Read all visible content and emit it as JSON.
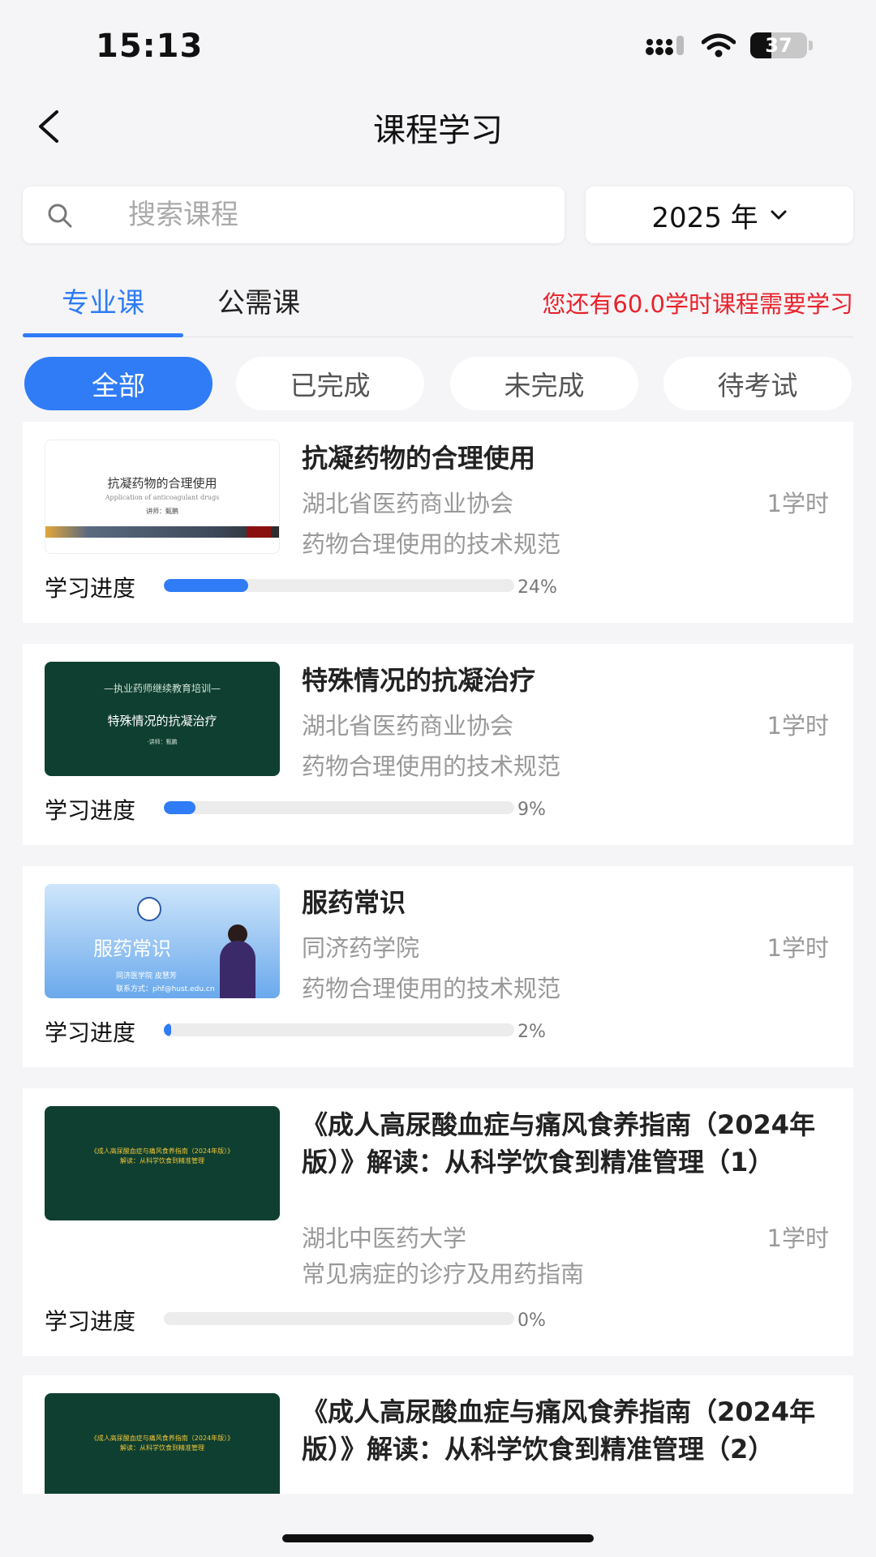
{
  "status_bar": {
    "time": "15:13",
    "battery": "37",
    "battery_level": 0.37
  },
  "header": {
    "title": "课程学习"
  },
  "search": {
    "placeholder": "搜索课程"
  },
  "year_filter": {
    "label": "2025 年"
  },
  "tabs": [
    {
      "label": "专业课",
      "active": true
    },
    {
      "label": "公需课",
      "active": false
    }
  ],
  "hours_notice": "您还有60.0学时课程需要学习",
  "filters": [
    {
      "label": "全部",
      "active": true
    },
    {
      "label": "已完成",
      "active": false
    },
    {
      "label": "未完成",
      "active": false
    },
    {
      "label": "待考试",
      "active": false
    }
  ],
  "progress_label": "学习进度",
  "colors": {
    "accent": "#2f7cf6",
    "notice": "#e8222b",
    "thumb_green": "#0f3f30"
  },
  "courses": [
    {
      "title": "抗凝药物的合理使用",
      "org": "湖北省医药商业协会",
      "hours": "1学时",
      "category": "药物合理使用的技术规范",
      "progress": 0.24,
      "progress_text": "24%",
      "thumb": {
        "title": "抗凝药物的合理使用",
        "subtitle": "Application of anticoagulant drugs",
        "speaker": "讲师：甄鹏"
      }
    },
    {
      "title": "特殊情况的抗凝治疗",
      "org": "湖北省医药商业协会",
      "hours": "1学时",
      "category": "药物合理使用的技术规范",
      "progress": 0.09,
      "progress_text": "9%",
      "thumb": {
        "header": "—执业药师继续教育培训—",
        "title": "特殊情况的抗凝治疗",
        "speaker": "·讲师：甄鹏"
      }
    },
    {
      "title": "服药常识",
      "org": "同济药学院",
      "hours": "1学时",
      "category": "药物合理使用的技术规范",
      "progress": 0.02,
      "progress_text": "2%",
      "thumb": {
        "title": "服药常识",
        "org": "同济医学院 皮慧芳",
        "contact": "联系方式：phf@hust.edu.cn"
      }
    },
    {
      "title": "《成人高尿酸血症与痛风食养指南（2024年版）》解读：从科学饮食到精准管理（1）",
      "org": "湖北中医药大学",
      "hours": "1学时",
      "category": "常见病症的诊疗及用药指南",
      "progress": 0.0,
      "progress_text": "0%",
      "thumb": {
        "line1": "《成人高尿酸血症与痛风食养指南（2024年版）》",
        "line2": "解读：从科学饮食到精准管理"
      }
    },
    {
      "title": "《成人高尿酸血症与痛风食养指南（2024年版）》解读：从科学饮食到精准管理（2）",
      "thumb": {
        "line1": "《成人高尿酸血症与痛风食养指南（2024年版）》",
        "line2": "解读：从科学饮食到精准管理"
      }
    }
  ]
}
